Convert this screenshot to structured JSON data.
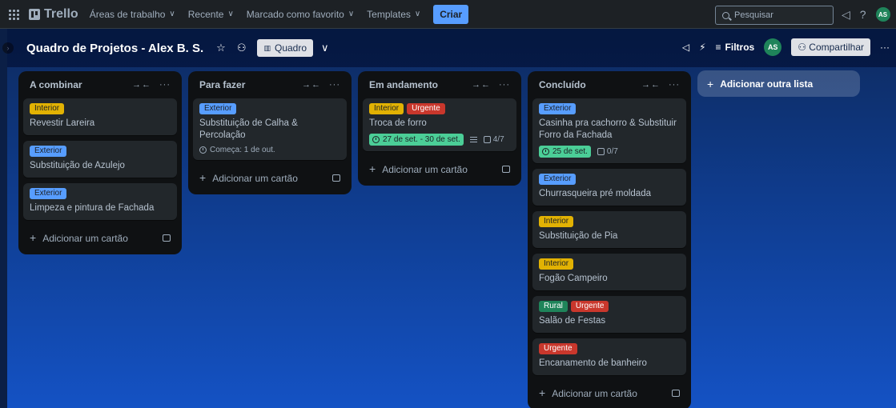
{
  "topbar": {
    "logo": "Trello",
    "menu": [
      "Áreas de trabalho",
      "Recente",
      "Marcado como favorito",
      "Templates"
    ],
    "create": "Criar",
    "search_placeholder": "Pesquisar",
    "avatar": "AS"
  },
  "board": {
    "title": "Quadro de Projetos - Alex B. S.",
    "view": "Quadro",
    "filters": "Filtros",
    "avatar": "AS",
    "share": "Compartilhar",
    "add_list": "Adicionar outra lista",
    "add_card": "Adicionar um cartão"
  },
  "colors": {
    "Interior": "#e2b203",
    "Exterior": "#579dff",
    "Urgente": "#c9372c",
    "Rural": "#1f845a"
  },
  "lists": [
    {
      "title": "A combinar",
      "cards": [
        {
          "labels": [
            "Interior"
          ],
          "title": "Revestir Lareira"
        },
        {
          "labels": [
            "Exterior"
          ],
          "title": "Substituição de Azulejo"
        },
        {
          "labels": [
            "Exterior"
          ],
          "title": "Limpeza e pintura de Fachada"
        }
      ]
    },
    {
      "title": "Para fazer",
      "cards": [
        {
          "labels": [
            "Exterior"
          ],
          "title": "Substituição de Calha & Percolação",
          "start": "Começa: 1 de out."
        }
      ]
    },
    {
      "title": "Em andamento",
      "cards": [
        {
          "labels": [
            "Interior",
            "Urgente"
          ],
          "title": "Troca de forro",
          "date": "27 de set. - 30 de set.",
          "description": true,
          "checklist": "4/7"
        }
      ]
    },
    {
      "title": "Concluído",
      "cards": [
        {
          "labels": [
            "Exterior"
          ],
          "title": "Casinha pra cachorro & Substituir Forro da Fachada",
          "date": "25 de set.",
          "checklist": "0/7"
        },
        {
          "labels": [
            "Exterior"
          ],
          "title": "Churrasqueira pré moldada"
        },
        {
          "labels": [
            "Interior"
          ],
          "title": "Substituição de Pia"
        },
        {
          "labels": [
            "Interior"
          ],
          "title": "Fogão Campeiro"
        },
        {
          "labels": [
            "Rural",
            "Urgente"
          ],
          "title": "Salão de Festas"
        },
        {
          "labels": [
            "Urgente"
          ],
          "title": "Encanamento de banheiro"
        }
      ]
    }
  ]
}
